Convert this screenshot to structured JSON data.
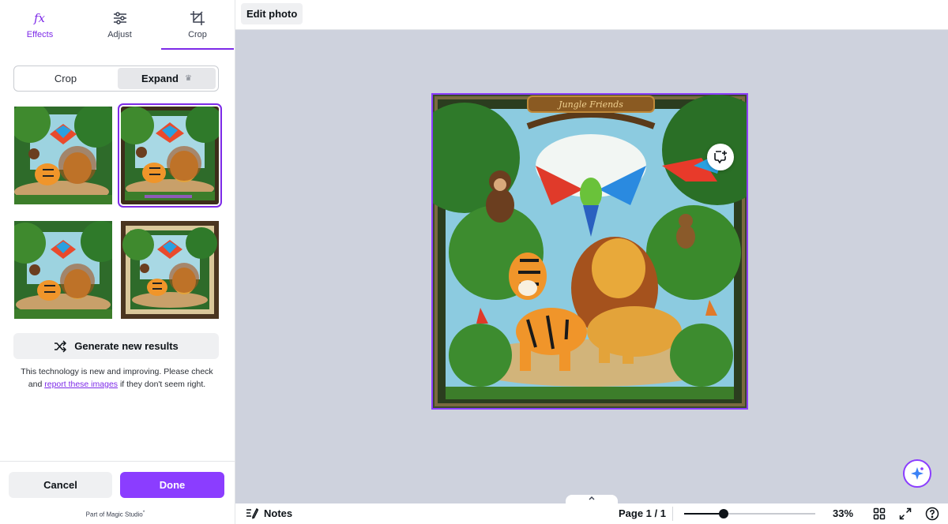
{
  "tabs": [
    {
      "label": "Effects",
      "icon": "fx-icon"
    },
    {
      "label": "Adjust",
      "icon": "sliders-icon"
    },
    {
      "label": "Crop",
      "icon": "crop-icon"
    }
  ],
  "active_tab": "Crop",
  "segmented": {
    "crop_label": "Crop",
    "expand_label": "Expand",
    "expand_badge": "crown-icon"
  },
  "thumbnails": [
    "variant 1",
    "variant 2 (selected)",
    "variant 3",
    "variant 4"
  ],
  "generate_label": "Generate new results",
  "notice": {
    "before": "This technology is new and improving. Please check and ",
    "link": "report these images",
    "after": " if they don't seem right."
  },
  "cancel_label": "Cancel",
  "done_label": "Done",
  "studio_label": "Part of Magic Studio",
  "studio_mark": "*",
  "topbar": {
    "edit_photo_label": "Edit photo"
  },
  "canvas": {
    "image_title_banner": "Jungle Friends",
    "canvas_bg": "#ced2dd",
    "accent": "#8b3dff"
  },
  "bottombar": {
    "notes_label": "Notes",
    "page_label": "Page 1 / 1",
    "zoom_label": "33%",
    "zoom_fraction": 0.3
  }
}
